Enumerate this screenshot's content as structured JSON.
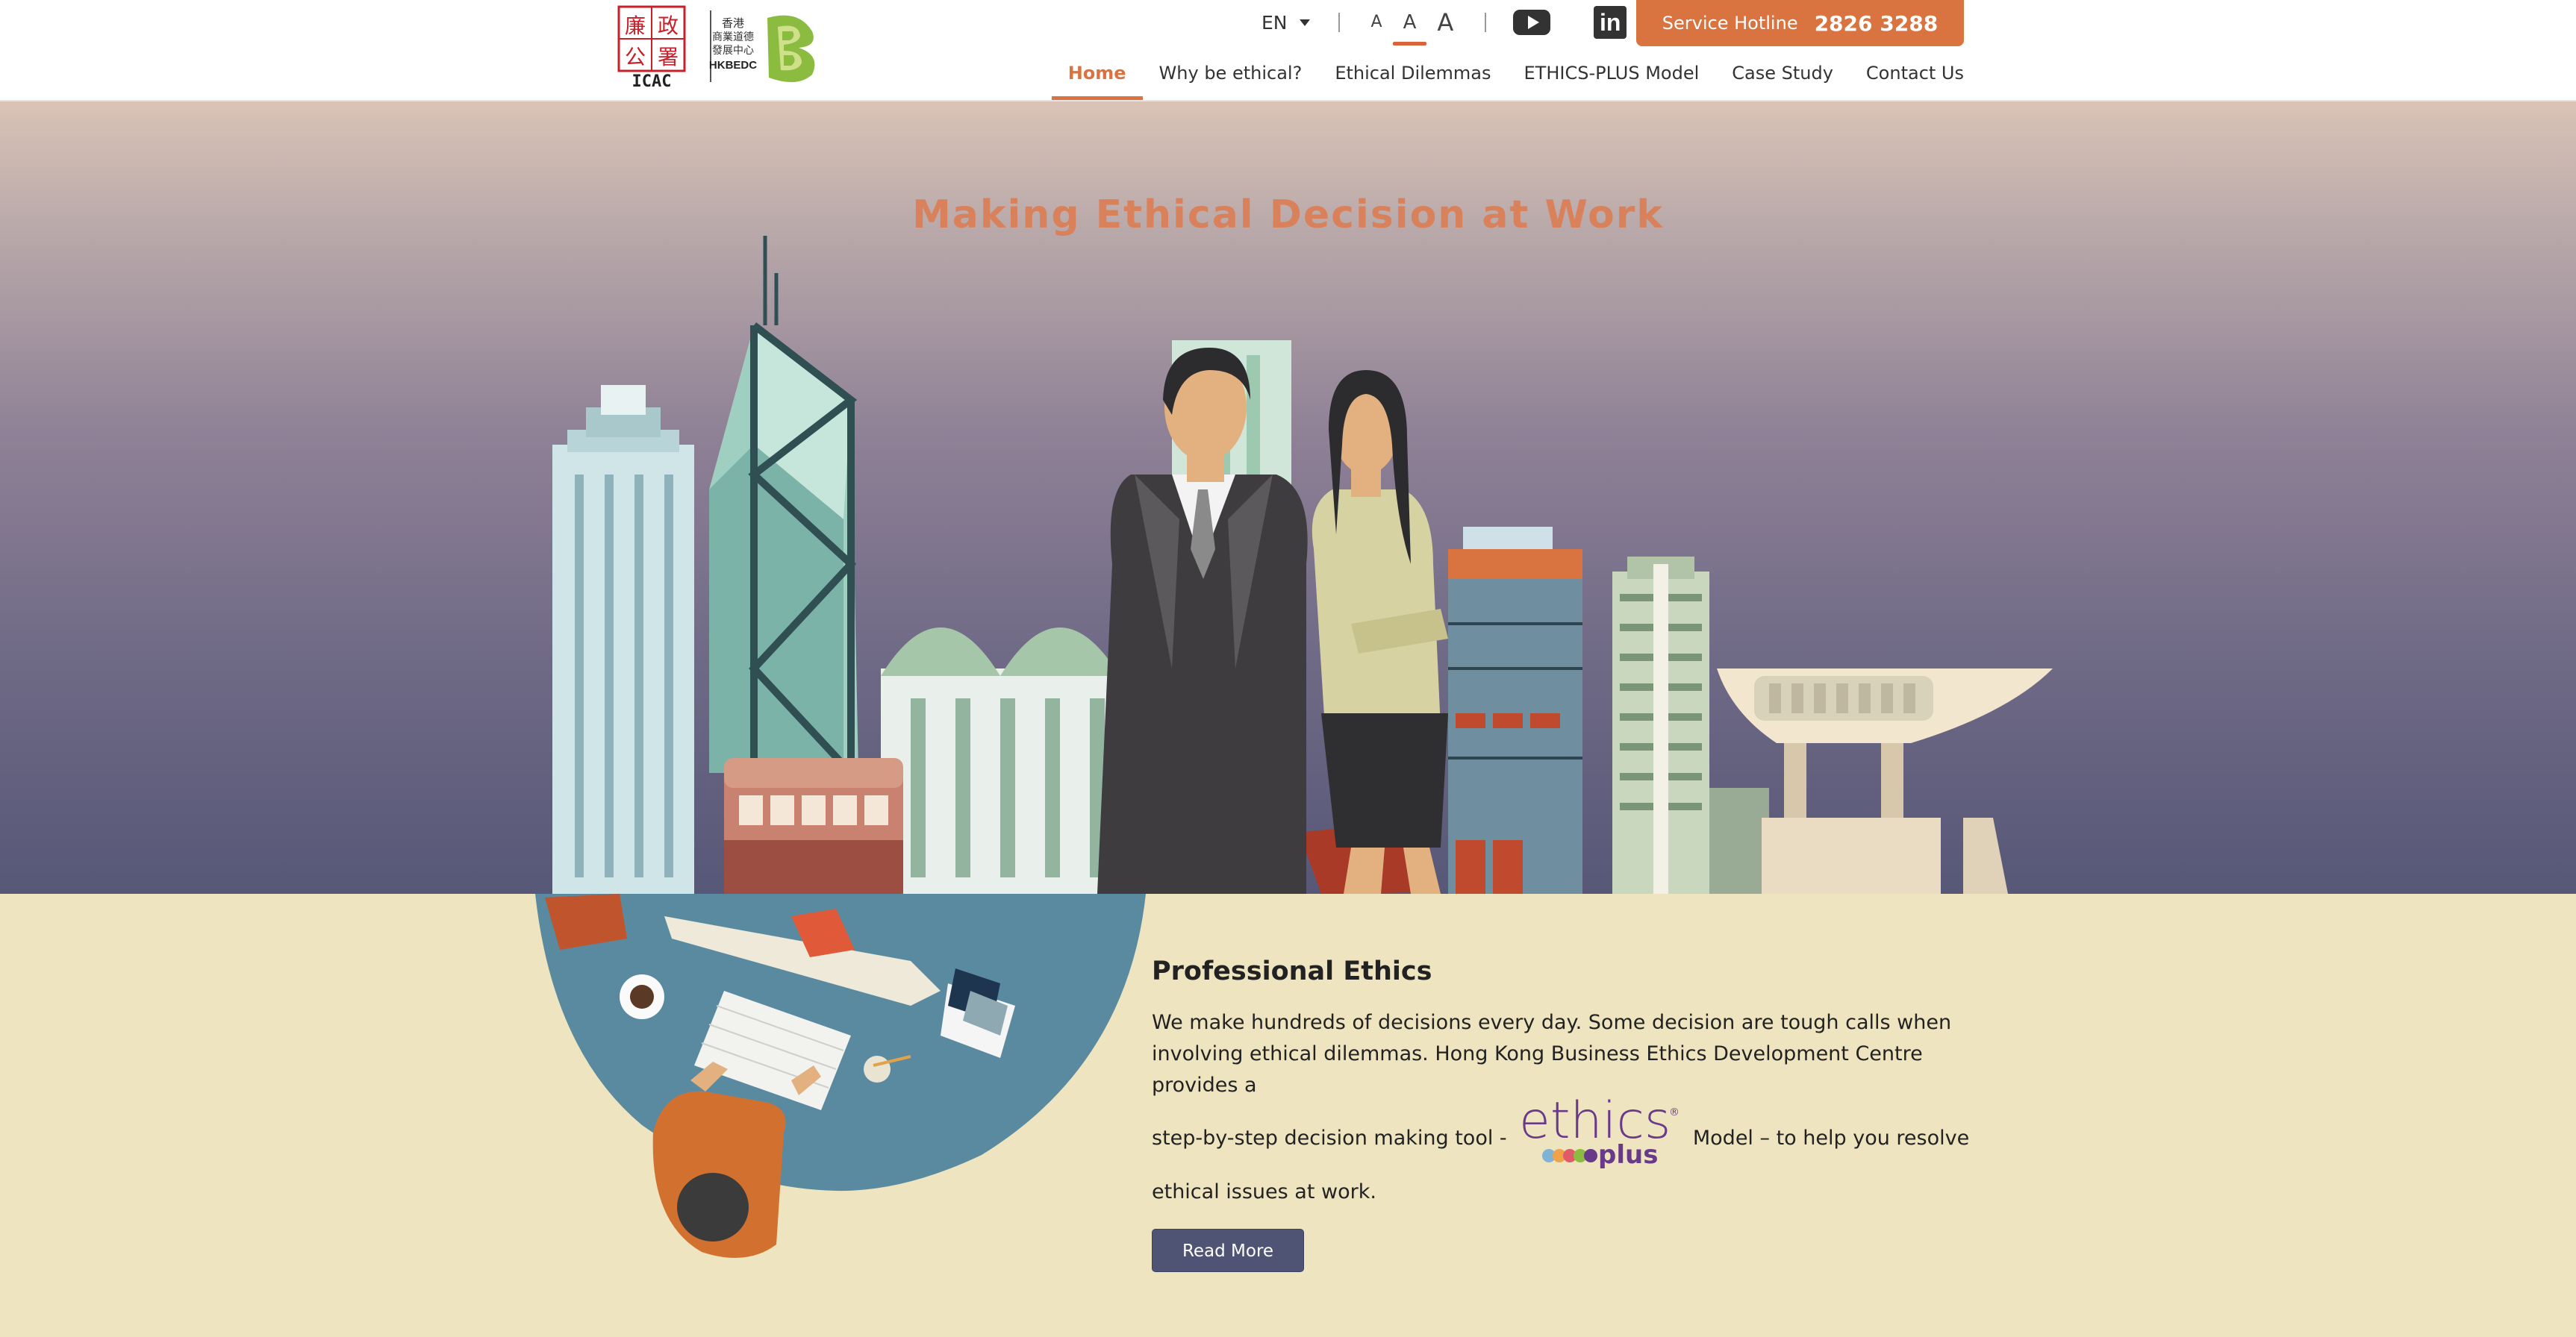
{
  "header": {
    "logo_icac_alt": "ICAC",
    "logo_icac_chinese": "廉政公署",
    "logo_hkbedc_chinese": "香港商業道德發展中心",
    "logo_hkbedc_abbr": "HKBEDC",
    "language": "EN",
    "font_size_labels": [
      "A",
      "A",
      "A"
    ],
    "hotline_label": "Service Hotline",
    "hotline_number": "2826 3288",
    "nav": [
      {
        "label": "Home",
        "active": true
      },
      {
        "label": "Why be ethical?"
      },
      {
        "label": "Ethical Dilemmas"
      },
      {
        "label": "ETHICS-PLUS Model"
      },
      {
        "label": "Case Study"
      },
      {
        "label": "Contact Us"
      }
    ],
    "colors": {
      "accent": "#d9733f",
      "brand_green": "#8bbb3f",
      "icac_red": "#c8202a"
    }
  },
  "hero": {
    "title": "Making Ethical Decision at Work"
  },
  "content": {
    "title": "Professional Ethics",
    "body_line_1": "We make hundreds of decisions every day. Some decision are tough calls when",
    "body_line_2": "involving ethical dilemmas. Hong Kong Business Ethics Development Centre provides a",
    "body_line_3a": "step-by-step decision making tool -",
    "body_line_3b": "Model – to help you resolve",
    "body_line_4": "ethical issues at work.",
    "inline_logo_word_1": "ethics",
    "inline_logo_word_2": "plus",
    "read_more_label": "Read More"
  }
}
